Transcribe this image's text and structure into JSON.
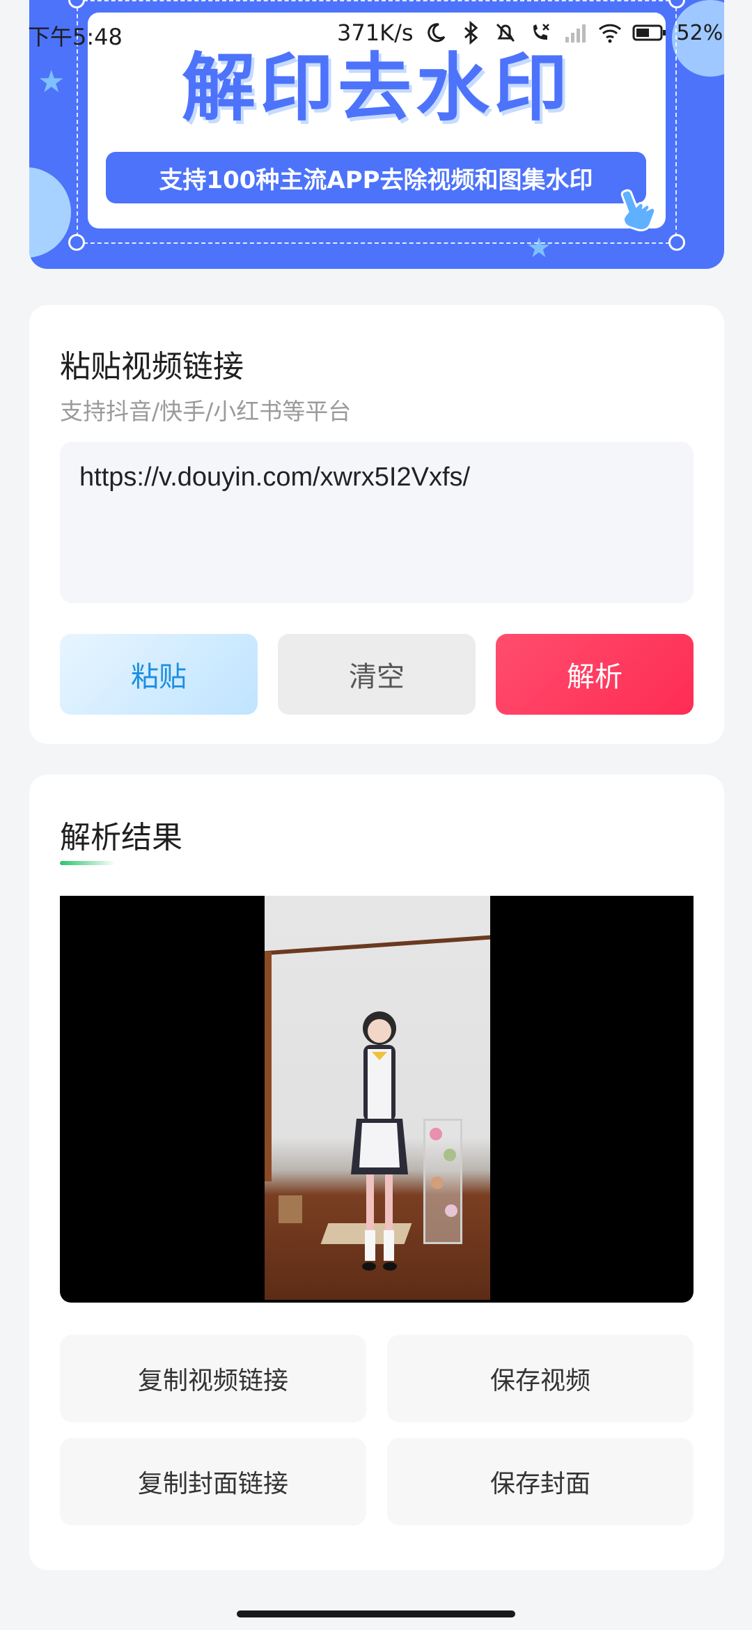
{
  "status_bar": {
    "time": "下午5:48",
    "net_speed": "371K/s",
    "battery": "52%",
    "icons": [
      "moon-icon",
      "bluetooth-icon",
      "bell-muted-icon",
      "call-blocked-icon",
      "signal-icon",
      "wifi-icon",
      "battery-icon"
    ]
  },
  "banner": {
    "title": "解印去水印",
    "subtitle": "支持100种主流APP去除视频和图集水印",
    "colors": {
      "primary": "#4d73fb",
      "light": "#a7d2ff"
    }
  },
  "input_card": {
    "title": "粘贴视频链接",
    "subtitle": "支持抖音/快手/小红书等平台",
    "url_value": "https://v.douyin.com/xwrx5I2Vxfs/",
    "buttons": {
      "paste": "粘贴",
      "clear": "清空",
      "parse": "解析"
    }
  },
  "result_card": {
    "title": "解析结果",
    "actions": {
      "copy_video_link": "复制视频链接",
      "save_video": "保存视频",
      "copy_cover_link": "复制封面链接",
      "save_cover": "保存封面"
    }
  }
}
